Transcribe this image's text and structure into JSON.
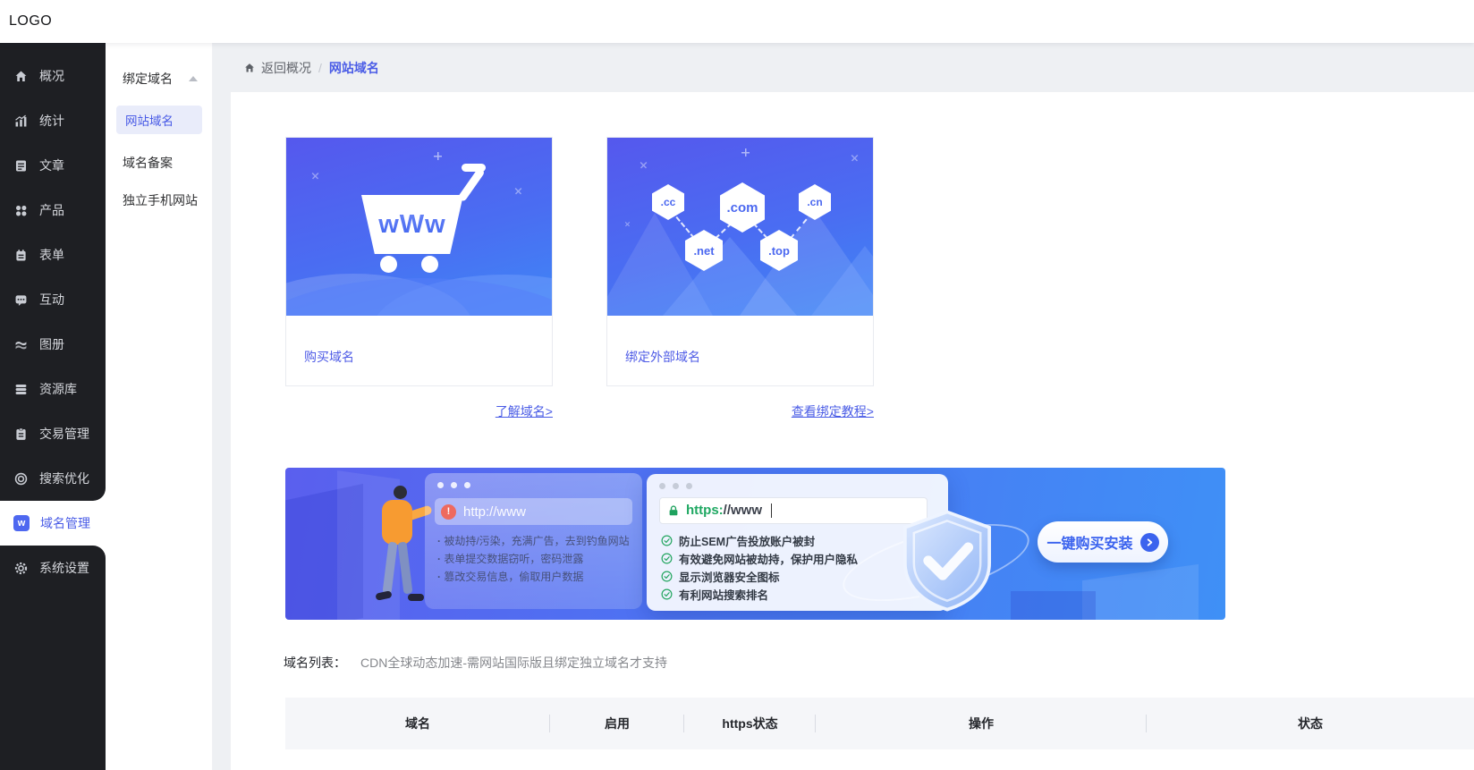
{
  "topbar": {
    "logo": "LOGO"
  },
  "colors": {
    "accent_blue": "#4a5ce6",
    "sidebar_bg": "#1e1f23",
    "banner_gradient": [
      "#5a5fee",
      "#3f90f6"
    ],
    "warning_red": "#ee6a5f",
    "success_green": "#28a763"
  },
  "sidebar": {
    "items": [
      {
        "label": "概况",
        "icon": "home-icon"
      },
      {
        "label": "统计",
        "icon": "stats-icon"
      },
      {
        "label": "文章",
        "icon": "article-icon"
      },
      {
        "label": "产品",
        "icon": "product-icon"
      },
      {
        "label": "表单",
        "icon": "form-icon"
      },
      {
        "label": "互动",
        "icon": "chat-icon"
      },
      {
        "label": "图册",
        "icon": "gallery-icon"
      },
      {
        "label": "资源库",
        "icon": "database-icon"
      },
      {
        "label": "交易管理",
        "icon": "clipboard-icon"
      },
      {
        "label": "搜索优化",
        "icon": "seo-icon"
      },
      {
        "label": "域名管理",
        "icon": "domain-w-icon",
        "badge": "w",
        "active": true
      },
      {
        "label": "系统设置",
        "icon": "gear-icon"
      }
    ]
  },
  "submenu": {
    "group_label": "绑定域名",
    "items": [
      {
        "label": "网站域名",
        "active": true
      },
      {
        "label": "域名备案",
        "active": false
      },
      {
        "label": "独立手机网站",
        "active": false
      }
    ]
  },
  "breadcrumb": {
    "back": "返回概况",
    "separator": "/",
    "current": "网站域名"
  },
  "cards": [
    {
      "label": "购买域名",
      "art_text": "wWw",
      "link": "了解域名>"
    },
    {
      "label": "绑定外部域名",
      "link": "查看绑定教程>",
      "tlds": [
        ".cc",
        ".com",
        ".cn",
        ".net",
        ".top"
      ]
    }
  ],
  "banner": {
    "http_window": {
      "warn_mark": "!",
      "url": "http://www",
      "bullets": [
        "被劫持/污染，充满广告，去到钓鱼网站",
        "表单提交数据窃听，密码泄露",
        "篡改交易信息，偷取用户数据"
      ]
    },
    "https_window": {
      "url_scheme": "https:",
      "url_rest": "//www",
      "benefits": [
        "防止SEM广告投放账户被封",
        "有效避免网站被劫持，保护用户隐私",
        "显示浏览器安全图标",
        "有利网站搜索排名"
      ]
    },
    "cta_label": "一键购买安装"
  },
  "domain_list": {
    "label": "域名列表：",
    "hint": "CDN全球动态加速-需网站国际版且绑定独立域名才支持",
    "columns": [
      "域名",
      "启用",
      "https状态",
      "操作",
      "状态"
    ]
  }
}
